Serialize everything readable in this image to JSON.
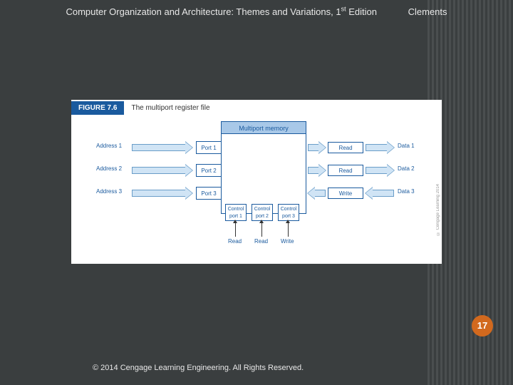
{
  "header": {
    "title_pre": "Computer Organization and Architecture: Themes and Variations, 1",
    "title_sup": "st",
    "title_post": " Edition",
    "author": "Clements"
  },
  "figure": {
    "tag": "FIGURE 7.6",
    "caption": "The multiport register file",
    "mem_title": "Multiport memory",
    "ports": [
      "Port 1",
      "Port 2",
      "Port 3"
    ],
    "ctrl": [
      "Control port 1",
      "Control port 2",
      "Control port 3"
    ],
    "addr": [
      "Address 1",
      "Address 2",
      "Address 3"
    ],
    "rw_right": [
      "Read",
      "Read",
      "Write"
    ],
    "data": [
      "Data 1",
      "Data 2",
      "Data 3"
    ],
    "ctrl_labels": [
      "Read",
      "Read",
      "Write"
    ],
    "credit": "© Cengage Learning 2014"
  },
  "page_number": "17",
  "copyright": "© 2014 Cengage Learning Engineering. All Rights Reserved."
}
